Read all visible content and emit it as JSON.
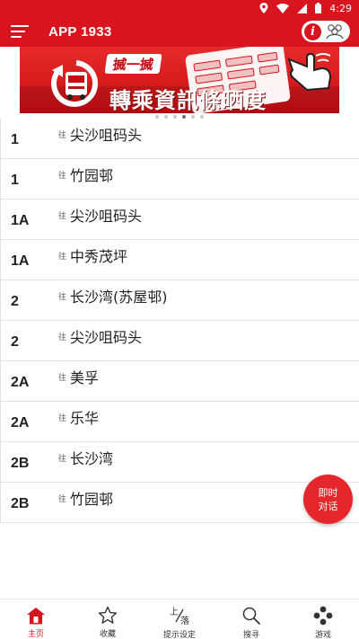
{
  "status_bar": {
    "time": "4:29",
    "icons": [
      "location-icon",
      "wifi-icon",
      "signal-icon",
      "battery-icon"
    ]
  },
  "app_bar": {
    "title": "APP 1933",
    "info_label": "i"
  },
  "banner": {
    "line1": "搣一搣",
    "line2": "轉乘資訊條晒度",
    "dot_count": 6,
    "active_dot": 3
  },
  "routes": [
    {
      "number": "1",
      "to_prefix": "往",
      "destination": "尖沙咀码头"
    },
    {
      "number": "1",
      "to_prefix": "往",
      "destination": "竹园邨"
    },
    {
      "number": "1A",
      "to_prefix": "往",
      "destination": "尖沙咀码头"
    },
    {
      "number": "1A",
      "to_prefix": "往",
      "destination": "中秀茂坪"
    },
    {
      "number": "2",
      "to_prefix": "往",
      "destination": "长沙湾(苏屋邨)"
    },
    {
      "number": "2",
      "to_prefix": "往",
      "destination": "尖沙咀码头"
    },
    {
      "number": "2A",
      "to_prefix": "往",
      "destination": "美孚"
    },
    {
      "number": "2A",
      "to_prefix": "往",
      "destination": "乐华"
    },
    {
      "number": "2B",
      "to_prefix": "往",
      "destination": "长沙湾"
    },
    {
      "number": "2B",
      "to_prefix": "往",
      "destination": "竹园邨"
    }
  ],
  "chat_button": {
    "line1": "即时",
    "line2": "对话"
  },
  "bottom_nav": [
    {
      "label": "主页",
      "icon": "home-icon",
      "active": true
    },
    {
      "label": "收藏",
      "icon": "star-icon",
      "active": false
    },
    {
      "label": "提示设定",
      "icon": "alight-icon",
      "icon_text_top": "上",
      "icon_text_bottom": "落",
      "active": false
    },
    {
      "label": "搜寻",
      "icon": "search-icon",
      "active": false
    },
    {
      "label": "游戏",
      "icon": "gamepad-icon",
      "active": false
    }
  ],
  "colors": {
    "brand_red": "#d8141e",
    "fab_red": "#e5262c",
    "divider": "#e3e3e3"
  }
}
